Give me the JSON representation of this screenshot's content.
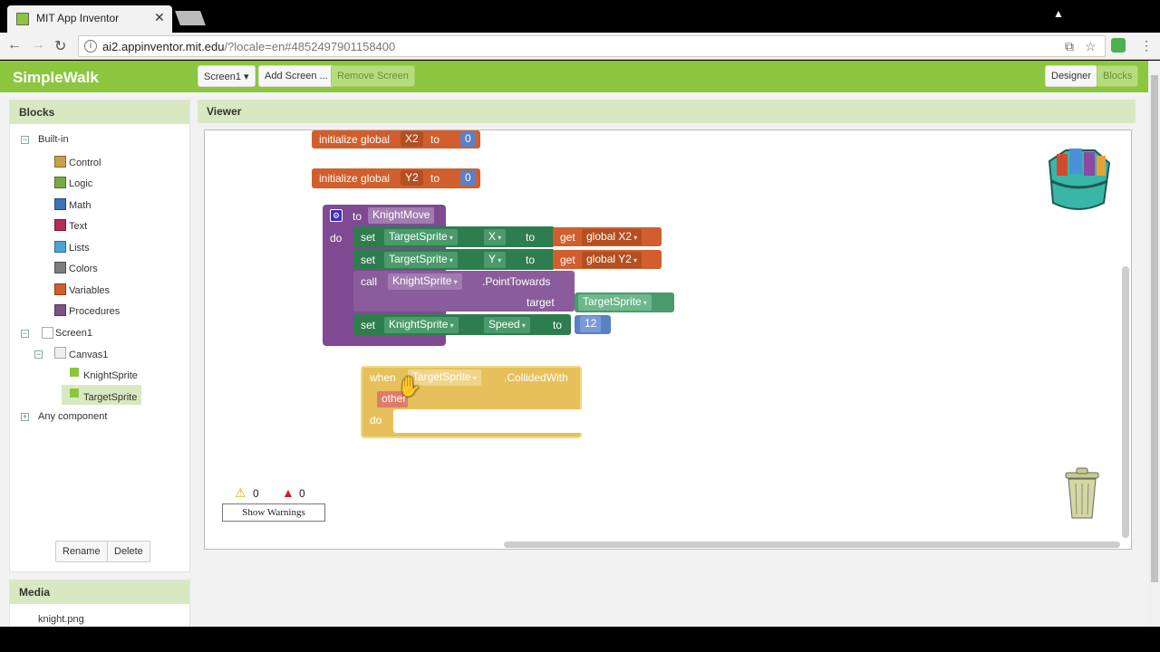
{
  "browser": {
    "tab_title": "MIT App Inventor",
    "url_host": "ai2.appinventor.mit.edu",
    "url_path": "/?locale=en#4852497901158400"
  },
  "appbar": {
    "title": "SimpleWalk",
    "screen_select": "Screen1 ▾",
    "add_screen": "Add Screen ...",
    "remove_screen": "Remove Screen",
    "designer": "Designer",
    "blocks": "Blocks"
  },
  "blocks_panel": {
    "header": "Blocks",
    "builtin": "Built-in",
    "items": [
      {
        "label": "Control",
        "color": "#c8a14a"
      },
      {
        "label": "Logic",
        "color": "#77ab41"
      },
      {
        "label": "Math",
        "color": "#3f71b5"
      },
      {
        "label": "Text",
        "color": "#b32d5e"
      },
      {
        "label": "Lists",
        "color": "#49a6d4"
      },
      {
        "label": "Colors",
        "color": "#7d7d7d"
      },
      {
        "label": "Variables",
        "color": "#d05f2d"
      },
      {
        "label": "Procedures",
        "color": "#7c5385"
      }
    ],
    "screen": "Screen1",
    "canvas": "Canvas1",
    "sprites": [
      "KnightSprite",
      "TargetSprite"
    ],
    "any_component": "Any component",
    "rename": "Rename",
    "delete": "Delete"
  },
  "media": {
    "header": "Media",
    "file": "knight.png"
  },
  "viewer": {
    "header": "Viewer",
    "init_x2": {
      "kw": "initialize global",
      "name": "X2",
      "to": "to",
      "value": "0"
    },
    "init_y2": {
      "kw": "initialize global",
      "name": "Y2",
      "to": "to",
      "value": "0"
    },
    "proc": {
      "to": "to",
      "name": "KnightMove",
      "do": "do",
      "set1": {
        "kw": "set",
        "comp": "TargetSprite",
        "prop": "X",
        "to": "to",
        "get": "get",
        "var": "global X2"
      },
      "set2": {
        "kw": "set",
        "comp": "TargetSprite",
        "prop": "Y",
        "to": "to",
        "get": "get",
        "var": "global Y2"
      },
      "call": {
        "kw": "call",
        "comp": "KnightSprite",
        "method": ".PointTowards",
        "arg": "target",
        "argval": "TargetSprite"
      },
      "set3": {
        "kw": "set",
        "comp": "KnightSprite",
        "prop": "Speed",
        "to": "to",
        "value": "12"
      }
    },
    "event": {
      "when": "when",
      "comp": "TargetSprite",
      "evt": ".CollidedWith",
      "param": "other",
      "do": "do"
    },
    "warnings_count": "0",
    "errors_count": "0",
    "show_warnings": "Show Warnings"
  }
}
